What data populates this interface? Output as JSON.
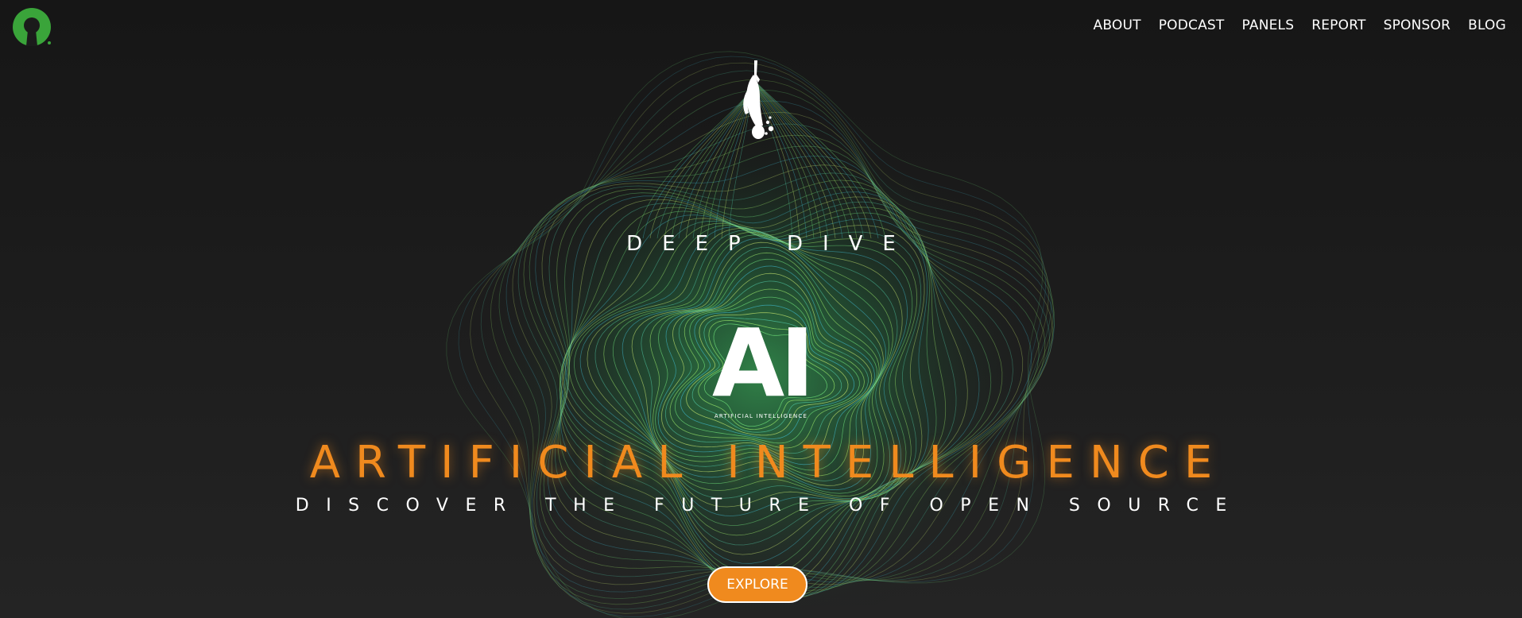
{
  "header": {
    "logo_icon": "open-source-initiative-keyhole-icon",
    "nav": [
      {
        "label": "ABOUT"
      },
      {
        "label": "PODCAST"
      },
      {
        "label": "PANELS"
      },
      {
        "label": "REPORT"
      },
      {
        "label": "SPONSOR"
      },
      {
        "label": "BLOG"
      }
    ]
  },
  "hero": {
    "diver_icon": "scuba-diver-icon",
    "kicker": "DEEP DIVE",
    "mark": "AI",
    "mark_caption": "ARTIFICIAL INTELLIGENCE",
    "headline": "ARTIFICIAL INTELLIGENCE",
    "tagline": "DISCOVER THE FUTURE OF OPEN SOURCE",
    "cta_label": "EXPLORE"
  },
  "colors": {
    "accent": "#f08a1e",
    "logo_green": "#3aa43a",
    "wave_green": "#5bd15b",
    "background": "#1b1b1b"
  }
}
